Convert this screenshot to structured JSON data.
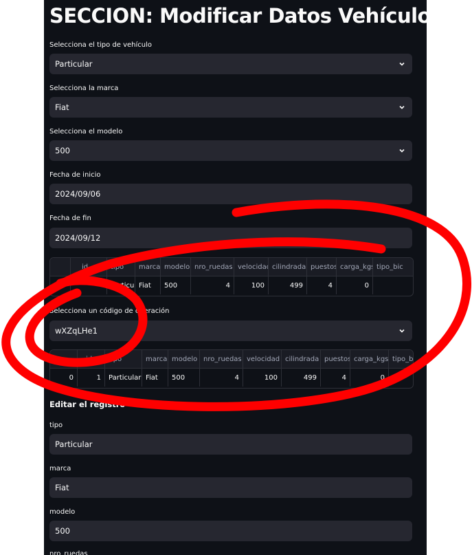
{
  "section_title": "SECCION: Modificar Datos Vehículo",
  "filters": {
    "tipo": {
      "label": "Selecciona el tipo de vehículo",
      "value": "Particular"
    },
    "marca": {
      "label": "Selecciona la marca",
      "value": "Fiat"
    },
    "modelo": {
      "label": "Selecciona el modelo",
      "value": "500"
    },
    "fecha_inicio": {
      "label": "Fecha de inicio",
      "value": "2024/09/06"
    },
    "fecha_fin": {
      "label": "Fecha de fin",
      "value": "2024/09/12"
    }
  },
  "table1": {
    "columns": [
      "",
      "id",
      "tipo",
      "marca",
      "modelo",
      "nro_ruedas",
      "velocidad",
      "cilindrada",
      "puestos",
      "carga_kgs",
      "tipo_bic"
    ],
    "row": [
      "",
      "",
      "Particul",
      "Fiat",
      "500",
      "4",
      "100",
      "499",
      "4",
      "0",
      ""
    ]
  },
  "operation": {
    "label": "Selecciona un código de operación",
    "value": "wXZqLHe1"
  },
  "table2": {
    "columns": [
      "",
      "id",
      "tipo",
      "marca",
      "modelo",
      "nro_ruedas",
      "velocidad",
      "cilindrada",
      "puestos",
      "carga_kgs",
      "tipo_b"
    ],
    "row": [
      "0",
      "1",
      "Particular",
      "Fiat",
      "500",
      "4",
      "100",
      "499",
      "4",
      "0",
      ""
    ]
  },
  "edit": {
    "title": "Editar el registro",
    "tipo": {
      "label": "tipo",
      "value": "Particular"
    },
    "marca": {
      "label": "marca",
      "value": "Fiat"
    },
    "modelo": {
      "label": "modelo",
      "value": "500"
    },
    "nro_ruedas": {
      "label": "nro_ruedas"
    }
  },
  "annotation_color": "#ff0000"
}
